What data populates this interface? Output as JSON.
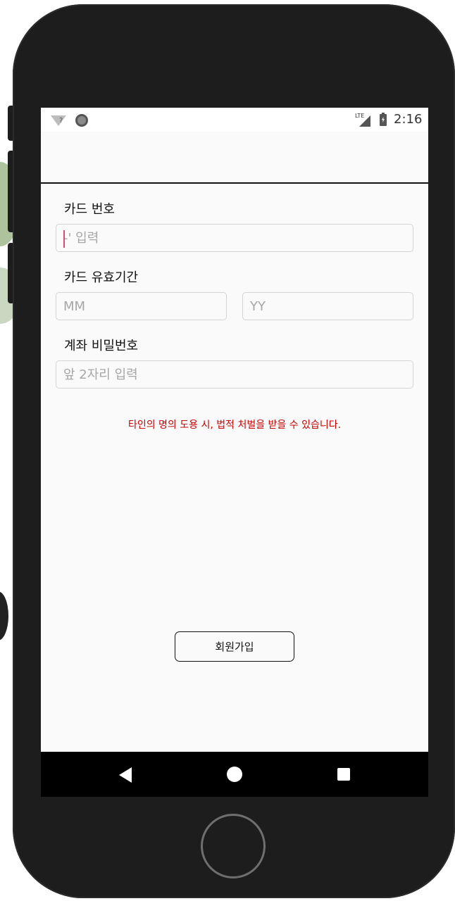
{
  "status_bar": {
    "wifi_icon": "wifi-unknown-icon",
    "wifi_badge": "?",
    "sync_icon": "sync-circle-icon",
    "network": "LTE",
    "time": "2:16"
  },
  "form": {
    "card_number": {
      "label": "카드 번호",
      "value": "",
      "placeholder": "-' 입력"
    },
    "card_expiry": {
      "label": "카드 유효기간",
      "month": {
        "value": "",
        "placeholder": "MM"
      },
      "year": {
        "value": "",
        "placeholder": "YY"
      }
    },
    "account_password": {
      "label": "계좌 비밀번호",
      "value": "",
      "placeholder": "앞 2자리 입력"
    },
    "warning_text": "타인의 명의 도용 시, 법적 처벌을 받을 수 있습니다.",
    "signup_label": "회원가입"
  },
  "colors": {
    "warning": "#c40000",
    "cursor": "#e0457b",
    "screen_bg": "#fafafa",
    "phone_body": "#1d1d1d"
  },
  "nav_bar": {
    "back_icon": "back-triangle-icon",
    "home_icon": "home-circle-icon",
    "recents_icon": "recents-square-icon"
  }
}
